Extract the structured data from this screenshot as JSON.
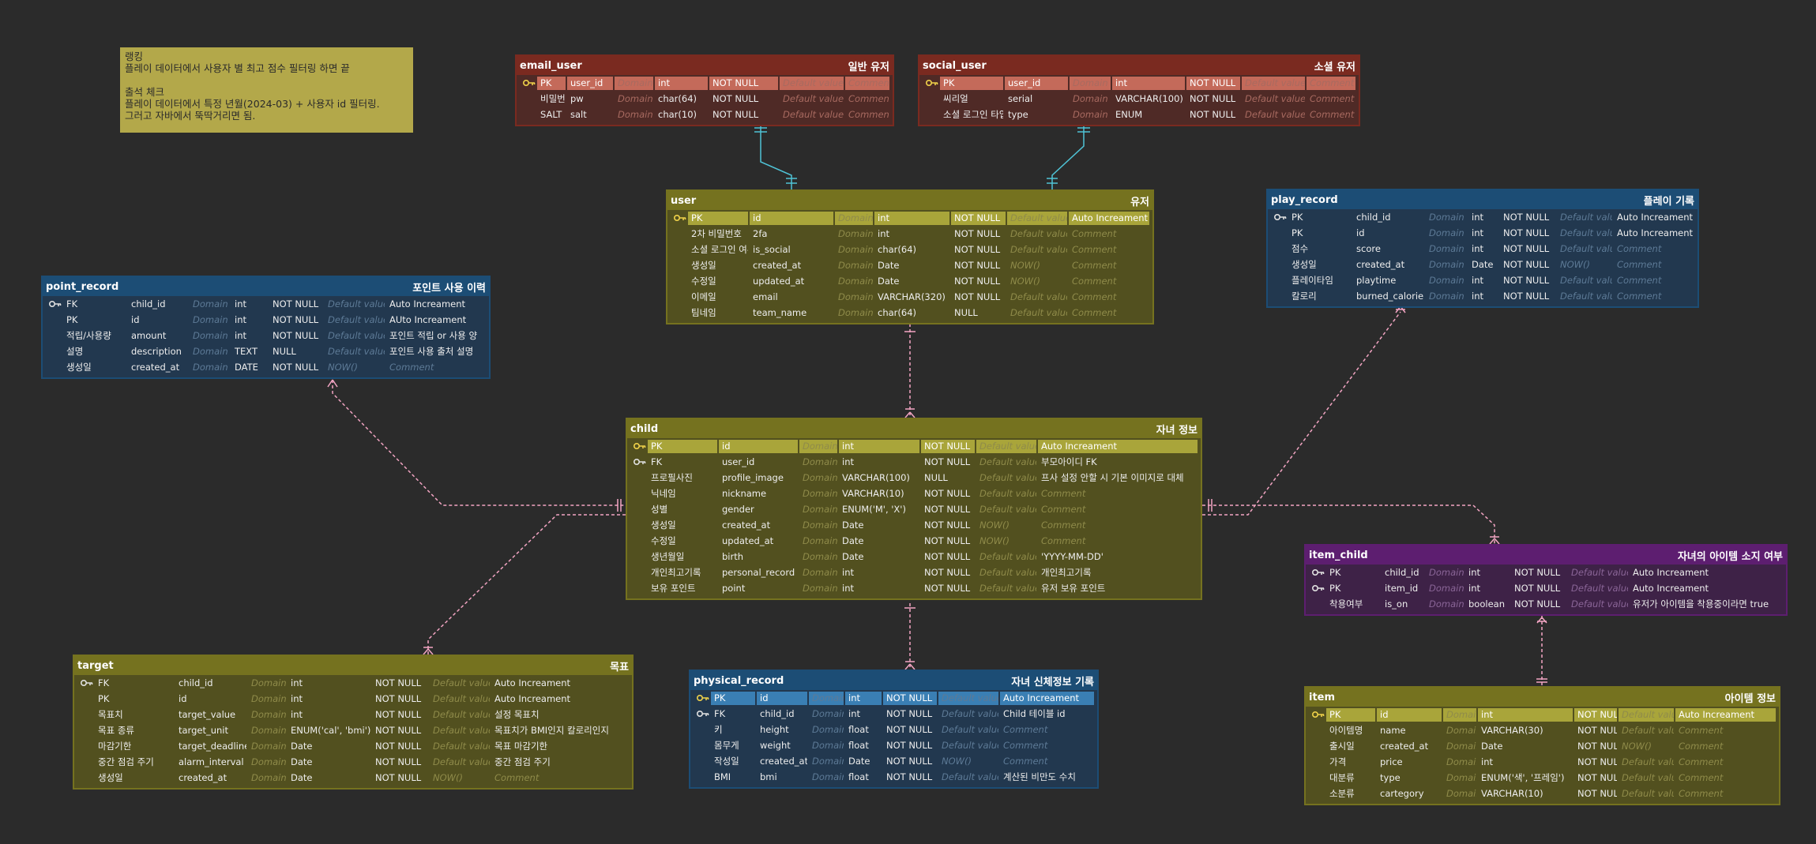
{
  "note": {
    "text": "랭킹\n플레이 데이터에서 사용자 별 최고 점수 필터링 하면 끝\n\n출석 체크\n플레이 데이터에서 특정 년월(2024-03) + 사용자 id 필터링.\n그러고 자바에서 뚝딱거리면 됨."
  },
  "tables": {
    "email_user": {
      "name": "email_user",
      "label": "일반 유저",
      "theme": "red",
      "rows": [
        {
          "key": "PK",
          "icon": "pk",
          "col": "user_id",
          "dom": "Domain",
          "type": "int",
          "nn": "NOT NULL",
          "def": "Default value",
          "cmt": "Comment",
          "highlight": true
        },
        {
          "key": "비밀번호",
          "col": "pw",
          "dom": "Domain",
          "type": "char(64)",
          "nn": "NOT NULL",
          "def": "Default value",
          "cmt": "Comment"
        },
        {
          "key": "SALT",
          "col": "salt",
          "dom": "Domain",
          "type": "char(10)",
          "nn": "NOT NULL",
          "def": "Default value",
          "cmt": "Comment"
        }
      ]
    },
    "social_user": {
      "name": "social_user",
      "label": "소셜 유저",
      "theme": "red",
      "rows": [
        {
          "key": "PK",
          "icon": "pk",
          "col": "user_id",
          "dom": "Domain",
          "type": "int",
          "nn": "NOT NULL",
          "def": "Default value",
          "cmt": "Comment",
          "highlight": true
        },
        {
          "key": "씨리얼",
          "col": "serial",
          "dom": "Domain",
          "type": "VARCHAR(100)",
          "nn": "NOT NULL",
          "def": "Default value",
          "cmt": "Comment"
        },
        {
          "key": "소셜 로그인 타입",
          "col": "type",
          "dom": "Domain",
          "type": "ENUM",
          "nn": "NOT NULL",
          "def": "Default value",
          "cmt": "Comment"
        }
      ]
    },
    "user": {
      "name": "user",
      "label": "유저",
      "theme": "olive",
      "rows": [
        {
          "key": "PK",
          "icon": "pk",
          "col": "id",
          "dom": "Domain",
          "type": "int",
          "nn": "NOT NULL",
          "def": "Default value",
          "cmt": "Auto Increament",
          "highlight": true
        },
        {
          "key": "2차 비밀번호",
          "col": "2fa",
          "dom": "Domain",
          "type": "int",
          "nn": "NOT NULL",
          "def": "Default value",
          "cmt": "Comment"
        },
        {
          "key": "소셜 로그인 여부",
          "col": "is_social",
          "dom": "Domain",
          "type": "char(64)",
          "nn": "NOT NULL",
          "def": "Default value",
          "cmt": "Comment"
        },
        {
          "key": "생성일",
          "col": "created_at",
          "dom": "Domain",
          "type": "Date",
          "nn": "NOT NULL",
          "def": "NOW()",
          "cmt": "Comment"
        },
        {
          "key": "수정일",
          "col": "updated_at",
          "dom": "Domain",
          "type": "Date",
          "nn": "NOT NULL",
          "def": "NOW()",
          "cmt": "Comment"
        },
        {
          "key": "이메일",
          "col": "email",
          "dom": "Domain",
          "type": "VARCHAR(320)",
          "nn": "NOT NULL",
          "def": "Default value",
          "cmt": "Comment"
        },
        {
          "key": "팀네임",
          "col": "team_name",
          "dom": "Domain",
          "type": "char(64)",
          "nn": "NULL",
          "def": "Default value",
          "cmt": "Comment"
        }
      ]
    },
    "play_record": {
      "name": "play_record",
      "label": "플레이 기록",
      "theme": "blue",
      "rows": [
        {
          "key": "PK",
          "icon": "pkfk",
          "col": "child_id",
          "dom": "Domain",
          "type": "int",
          "nn": "NOT NULL",
          "def": "Default value",
          "cmt": "Auto Increament"
        },
        {
          "key": "PK",
          "col": "id",
          "dom": "Domain",
          "type": "int",
          "nn": "NOT NULL",
          "def": "Default value",
          "cmt": "Auto Increament"
        },
        {
          "key": "점수",
          "col": "score",
          "dom": "Domain",
          "type": "int",
          "nn": "NOT NULL",
          "def": "Default value",
          "cmt": "Comment"
        },
        {
          "key": "생성일",
          "col": "created_at",
          "dom": "Domain",
          "type": "Date",
          "nn": "NOT NULL",
          "def": "NOW()",
          "cmt": "Comment"
        },
        {
          "key": "플레이타임",
          "col": "playtime",
          "dom": "Domain",
          "type": "int",
          "nn": "NOT NULL",
          "def": "Default value",
          "cmt": "Comment"
        },
        {
          "key": "칼로리",
          "col": "burned_calorie",
          "dom": "Domain",
          "type": "int",
          "nn": "NOT NULL",
          "def": "Default value",
          "cmt": "Comment"
        }
      ]
    },
    "point_record": {
      "name": "point_record",
      "label": "포인트 사용 이력",
      "theme": "blue",
      "rows": [
        {
          "key": "FK",
          "icon": "fk",
          "col": "child_id",
          "dom": "Domain",
          "type": "int",
          "nn": "NOT NULL",
          "def": "Default value",
          "cmt": "Auto Increament"
        },
        {
          "key": "PK",
          "col": "id",
          "dom": "Domain",
          "type": "int",
          "nn": "NOT NULL",
          "def": "Default value",
          "cmt": "AUto Increament"
        },
        {
          "key": "적립/사용량",
          "col": "amount",
          "dom": "Domain",
          "type": "int",
          "nn": "NOT NULL",
          "def": "Default value",
          "cmt": "포인트 적립 or 사용 양"
        },
        {
          "key": "설명",
          "col": "description",
          "dom": "Domain",
          "type": "TEXT",
          "nn": "NULL",
          "def": "Default value",
          "cmt": "포인트 사용 출처 설명"
        },
        {
          "key": "생성일",
          "col": "created_at",
          "dom": "Domain",
          "type": "DATE",
          "nn": "NOT NULL",
          "def": "NOW()",
          "cmt": "Comment"
        }
      ]
    },
    "child": {
      "name": "child",
      "label": "자녀 정보",
      "theme": "olive",
      "rows": [
        {
          "key": "PK",
          "icon": "pk",
          "col": "id",
          "dom": "Domain",
          "type": "int",
          "nn": "NOT NULL",
          "def": "Default value",
          "cmt": "Auto Increament",
          "highlight": true
        },
        {
          "key": "FK",
          "icon": "fk",
          "col": "user_id",
          "dom": "Domain",
          "type": "int",
          "nn": "NOT NULL",
          "def": "Default value",
          "cmt": "부모아이디 FK"
        },
        {
          "key": "프로필사진",
          "col": "profile_image",
          "dom": "Domain",
          "type": "VARCHAR(100)",
          "nn": "NULL",
          "def": "Default value",
          "cmt": "프사 설정 안할 시 기본 이미지로 대체"
        },
        {
          "key": "닉네임",
          "col": "nickname",
          "dom": "Domain",
          "type": "VARCHAR(10)",
          "nn": "NOT NULL",
          "def": "Default value",
          "cmt": "Comment"
        },
        {
          "key": "성별",
          "col": "gender",
          "dom": "Domain",
          "type": "ENUM('M', 'X')",
          "nn": "NOT NULL",
          "def": "Default value",
          "cmt": "Comment"
        },
        {
          "key": "생성일",
          "col": "created_at",
          "dom": "Domain",
          "type": "Date",
          "nn": "NOT NULL",
          "def": "NOW()",
          "cmt": "Comment"
        },
        {
          "key": "수정일",
          "col": "updated_at",
          "dom": "Domain",
          "type": "Date",
          "nn": "NOT NULL",
          "def": "NOW()",
          "cmt": "Comment"
        },
        {
          "key": "생년월일",
          "col": "birth",
          "dom": "Domain",
          "type": "Date",
          "nn": "NOT NULL",
          "def": "Default value",
          "cmt": "'YYYY-MM-DD'"
        },
        {
          "key": "개인최고기록",
          "col": "personal_record",
          "dom": "Domain",
          "type": "int",
          "nn": "NOT NULL",
          "def": "Default value",
          "cmt": "개인최고기록"
        },
        {
          "key": "보유 포인트",
          "col": "point",
          "dom": "Domain",
          "type": "int",
          "nn": "NOT NULL",
          "def": "Default value",
          "cmt": "유저 보유 포인트"
        }
      ]
    },
    "item_child": {
      "name": "item_child",
      "label": "자녀의 아이템 소지 여부",
      "theme": "purple",
      "rows": [
        {
          "key": "PK",
          "icon": "pkfk",
          "col": "child_id",
          "dom": "Domain",
          "type": "int",
          "nn": "NOT NULL",
          "def": "Default value",
          "cmt": "Auto Increament"
        },
        {
          "key": "PK",
          "icon": "pkfk",
          "col": "item_id",
          "dom": "Domain",
          "type": "int",
          "nn": "NOT NULL",
          "def": "Default value",
          "cmt": "Auto Increament"
        },
        {
          "key": "착용여부",
          "col": "is_on",
          "dom": "Domain",
          "type": "boolean",
          "nn": "NOT NULL",
          "def": "Default value",
          "cmt": "유저가 아이템을 착용중이라면 true"
        }
      ]
    },
    "target": {
      "name": "target",
      "label": "목표",
      "theme": "olive",
      "rows": [
        {
          "key": "FK",
          "icon": "fk",
          "col": "child_id",
          "dom": "Domain",
          "type": "int",
          "nn": "NOT NULL",
          "def": "Default value",
          "cmt": "Auto Increament"
        },
        {
          "key": "PK",
          "col": "id",
          "dom": "Domain",
          "type": "int",
          "nn": "NOT NULL",
          "def": "Default value",
          "cmt": "Auto Increament"
        },
        {
          "key": "목표치",
          "col": "target_value",
          "dom": "Domain",
          "type": "int",
          "nn": "NOT NULL",
          "def": "Default value",
          "cmt": "설정 목표치"
        },
        {
          "key": "목표 종류",
          "col": "target_unit",
          "dom": "Domain",
          "type": "ENUM('cal', 'bmi')",
          "nn": "NOT NULL",
          "def": "Default value",
          "cmt": "목표치가 BMI인지 칼로리인지"
        },
        {
          "key": "마감기한",
          "col": "target_deadline",
          "dom": "Domain",
          "type": "Date",
          "nn": "NOT NULL",
          "def": "Default value",
          "cmt": "목표 마감기한"
        },
        {
          "key": "중간 점검 주기",
          "col": "alarm_interval",
          "dom": "Domain",
          "type": "Date",
          "nn": "NOT NULL",
          "def": "Default value",
          "cmt": "중간 점검 주기"
        },
        {
          "key": "생성일",
          "col": "created_at",
          "dom": "Domain",
          "type": "Date",
          "nn": "NOT NULL",
          "def": "NOW()",
          "cmt": "Comment"
        }
      ]
    },
    "physical_record": {
      "name": "physical_record",
      "label": "자녀 신체정보 기록",
      "theme": "blue",
      "rows": [
        {
          "key": "PK",
          "icon": "pk",
          "col": "id",
          "dom": "Domain",
          "type": "int",
          "nn": "NOT NULL",
          "def": "Default value",
          "cmt": "Auto Increament",
          "highlight": true
        },
        {
          "key": "FK",
          "icon": "fk",
          "col": "child_id",
          "dom": "Domain",
          "type": "int",
          "nn": "NOT NULL",
          "def": "Default value",
          "cmt": "Child 테이블 id"
        },
        {
          "key": "키",
          "col": "height",
          "dom": "Domain",
          "type": "float",
          "nn": "NOT NULL",
          "def": "Default value",
          "cmt": "Comment"
        },
        {
          "key": "몸무게",
          "col": "weight",
          "dom": "Domain",
          "type": "float",
          "nn": "NOT NULL",
          "def": "Default value",
          "cmt": "Comment"
        },
        {
          "key": "작성일",
          "col": "created_at",
          "dom": "Domain",
          "type": "Date",
          "nn": "NOT NULL",
          "def": "NOW()",
          "cmt": "Comment"
        },
        {
          "key": "BMI",
          "col": "bmi",
          "dom": "Domain",
          "type": "float",
          "nn": "NOT NULL",
          "def": "Default value",
          "cmt": "계산된 비만도 수치"
        }
      ]
    },
    "item": {
      "name": "item",
      "label": "아이템 정보",
      "theme": "olive",
      "rows": [
        {
          "key": "PK",
          "icon": "pk",
          "col": "id",
          "dom": "Domain",
          "type": "int",
          "nn": "NOT NULL",
          "def": "Default value",
          "cmt": "Auto Increament",
          "highlight": true
        },
        {
          "key": "아이템명",
          "col": "name",
          "dom": "Domain",
          "type": "VARCHAR(30)",
          "nn": "NOT NULL",
          "def": "Default value",
          "cmt": "Comment"
        },
        {
          "key": "출시일",
          "col": "created_at",
          "dom": "Domain",
          "type": "Date",
          "nn": "NOT NULL",
          "def": "NOW()",
          "cmt": "Comment"
        },
        {
          "key": "가격",
          "col": "price",
          "dom": "Domain",
          "type": "int",
          "nn": "NOT NULL",
          "def": "Default value",
          "cmt": "Comment"
        },
        {
          "key": "대분류",
          "col": "type",
          "dom": "Domain",
          "type": "ENUM('색', '프레임')",
          "nn": "NOT NULL",
          "def": "Default value",
          "cmt": "Comment"
        },
        {
          "key": "소분류",
          "col": "cartegory",
          "dom": "Domain",
          "type": "VARCHAR(10)",
          "nn": "NOT NULL",
          "def": "Default value",
          "cmt": "Comment"
        }
      ]
    }
  }
}
